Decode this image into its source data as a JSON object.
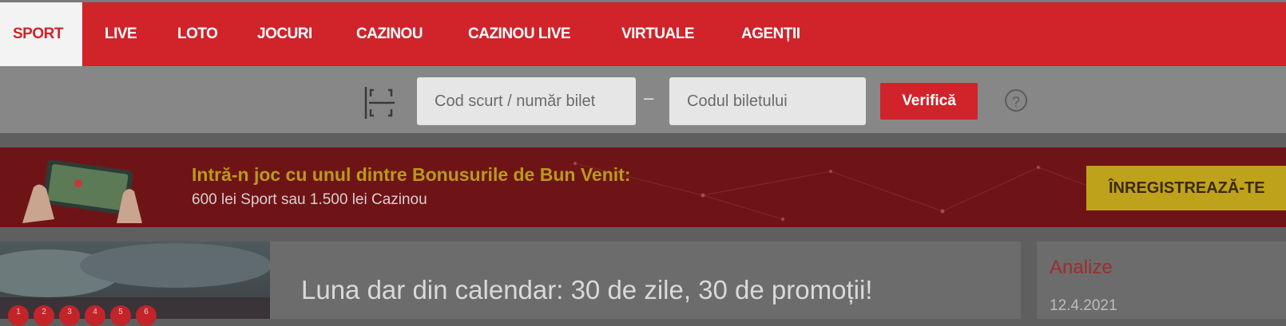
{
  "nav": {
    "items": [
      {
        "label": "SPORT",
        "active": true
      },
      {
        "label": "LIVE"
      },
      {
        "label": "LOTO"
      },
      {
        "label": "JOCURI"
      },
      {
        "label": "CAZINOU"
      },
      {
        "label": "CAZINOU LIVE"
      },
      {
        "label": "VIRTUALE"
      },
      {
        "label": "AGENȚII"
      }
    ]
  },
  "ticket": {
    "short_code_placeholder": "Cod scurt / număr bilet",
    "separator": "–",
    "ticket_code_placeholder": "Codul biletului",
    "verify_label": "Verifică",
    "help_symbol": "?"
  },
  "banner": {
    "title": "Intră-n joc cu unul dintre Bonusurile de Bun Venit:",
    "subtitle": "600 lei Sport sau 1.500 lei Cazinou",
    "register_label": "ÎNREGISTREAZĂ-TE"
  },
  "article": {
    "title": "Luna dar din calendar: 30 de zile, 30 de promoții!"
  },
  "side": {
    "title": "Analize",
    "date": "12.4.2021"
  },
  "promo_numbers": [
    "1",
    "2",
    "3",
    "4",
    "5",
    "6"
  ],
  "colors": {
    "brand_red": "#d0232a",
    "gold": "#bfa21c"
  },
  "icons": {
    "scan": "barcode-scan-icon",
    "help": "question-circle-icon"
  }
}
